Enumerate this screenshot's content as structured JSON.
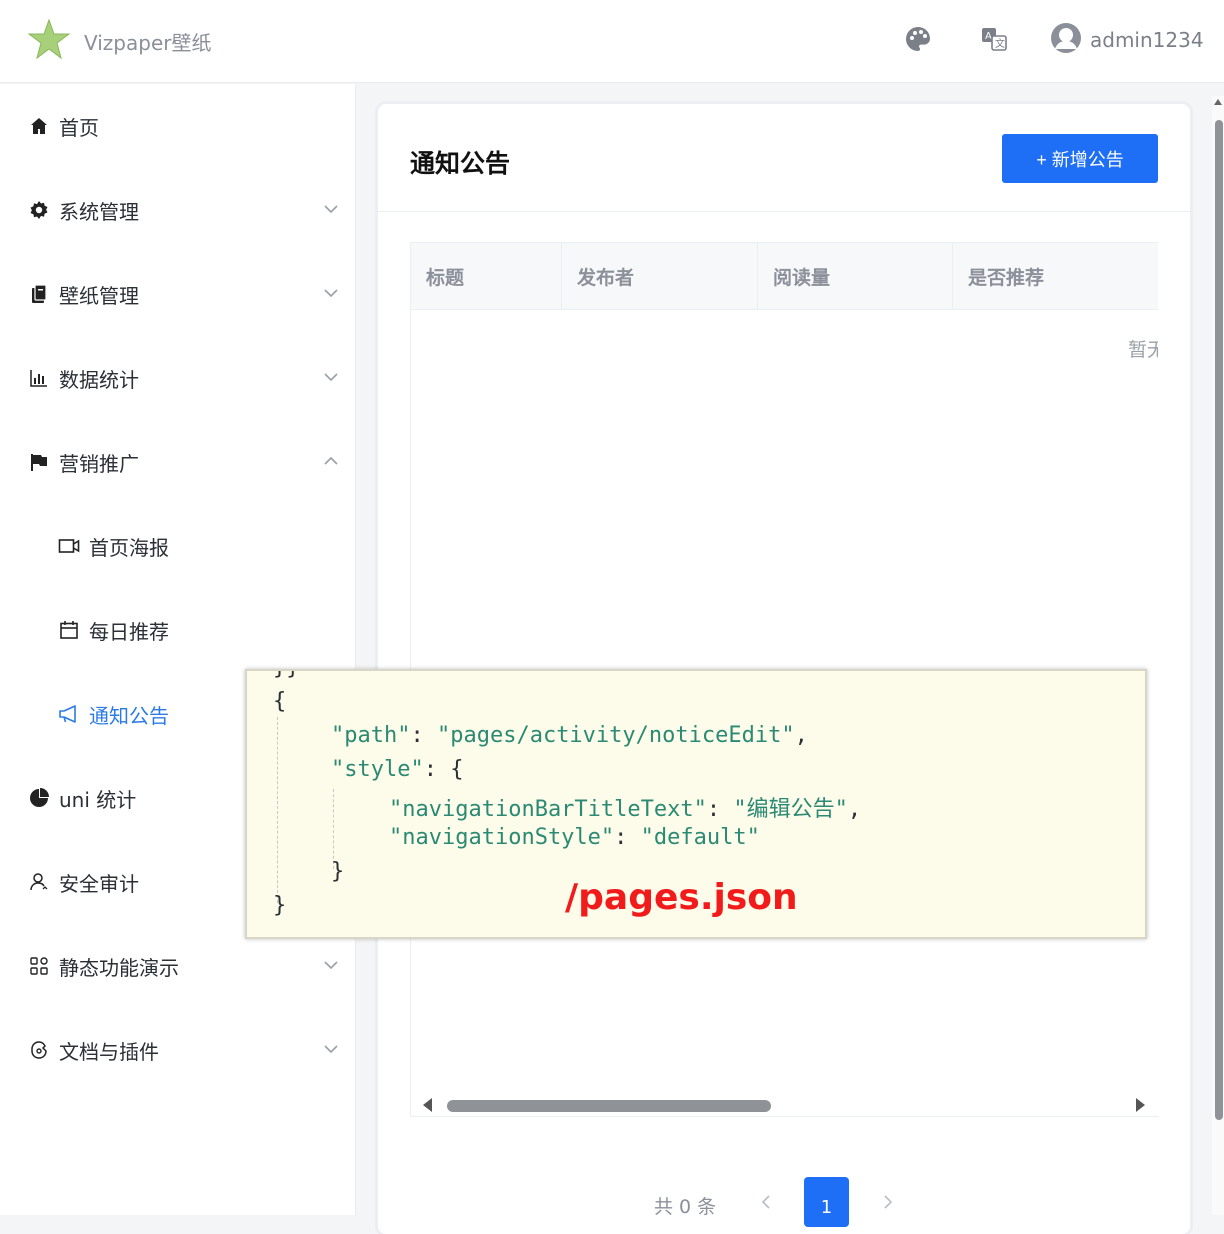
{
  "header": {
    "app_name": "Vizpaper壁纸",
    "user_name": "admin1234",
    "icons": [
      "star-logo-icon",
      "palette-icon",
      "translate-icon",
      "user-avatar-icon"
    ]
  },
  "sidebar": {
    "items": [
      {
        "label": "首页",
        "icon": "home-icon"
      },
      {
        "label": "系统管理",
        "icon": "gear-icon"
      },
      {
        "label": "壁纸管理",
        "icon": "clipboard-icon"
      },
      {
        "label": "数据统计",
        "icon": "bar-chart-icon"
      },
      {
        "label": "营销推广",
        "icon": "flag-icon"
      },
      {
        "label": "首页海报",
        "icon": "video-icon"
      },
      {
        "label": "每日推荐",
        "icon": "calendar-icon"
      },
      {
        "label": "通知公告",
        "icon": "megaphone-icon"
      },
      {
        "label": "uni 统计",
        "icon": "pie-icon"
      },
      {
        "label": "安全审计",
        "icon": "user-outline-icon"
      },
      {
        "label": "静态功能演示",
        "icon": "grid-icon"
      },
      {
        "label": "文档与插件",
        "icon": "puzzle-icon"
      }
    ]
  },
  "main": {
    "title": "通知公告",
    "add_button": "+ 新增公告",
    "columns": [
      "标题",
      "发布者",
      "阅读量",
      "是否推荐"
    ],
    "empty_text": "暂无",
    "pagination": {
      "total": "共 0 条",
      "page": "1"
    }
  },
  "overlay": {
    "line0": "}}",
    "line1": "{",
    "key_path": "\"path\"",
    "val_path": "\"pages/activity/noticeEdit\"",
    "key_style": "\"style\"",
    "key_nav_title": "\"navigationBarTitleText\"",
    "val_nav_title": "\"编辑公告\"",
    "key_nav_style": "\"navigationStyle\"",
    "val_nav_style": "\"default\"",
    "close_inner": "}",
    "close_outer": "}",
    "caption": "/pages.json"
  },
  "colors": {
    "primary": "#1e6ff5",
    "active_menu": "#2c7be5",
    "caption": "#f21b1b",
    "code_string": "#2b8a74"
  }
}
